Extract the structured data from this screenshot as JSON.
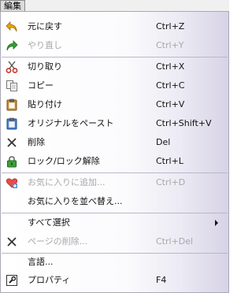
{
  "menubar": {
    "title": "編集"
  },
  "menu": {
    "undo": {
      "label": "元に戻す",
      "shortcut": "Ctrl+Z",
      "icon": "undo-arrow-icon"
    },
    "redo": {
      "label": "やり直し",
      "shortcut": "Ctrl+Y",
      "icon": "redo-arrow-icon"
    },
    "cut": {
      "label": "切り取り",
      "shortcut": "Ctrl+X",
      "icon": "scissors-icon"
    },
    "copy": {
      "label": "コピー",
      "shortcut": "Ctrl+C",
      "icon": "copy-pages-icon"
    },
    "paste": {
      "label": "貼り付け",
      "shortcut": "Ctrl+V",
      "icon": "clipboard-icon"
    },
    "paste_original": {
      "label": "オリジナルをペースト",
      "shortcut": "Ctrl+Shift+V",
      "icon": "clipboard-blue-icon"
    },
    "delete": {
      "label": "削除",
      "shortcut": "Del",
      "icon": "x-delete-icon"
    },
    "lock": {
      "label": "ロック/ロック解除",
      "shortcut": "Ctrl+L",
      "icon": "padlock-icon"
    },
    "add_favorite": {
      "label": "お気に入りに追加...",
      "shortcut": "Ctrl+D",
      "icon": "heart-plus-icon"
    },
    "sort_favorites": {
      "label": "お気に入りを並べ替え..."
    },
    "select_all": {
      "label": "すべて選択"
    },
    "delete_page": {
      "label": "ページの削除...",
      "shortcut": "Ctrl+Del",
      "icon": "x-delete-icon"
    },
    "language": {
      "label": "言語..."
    },
    "properties": {
      "label": "プロパティ",
      "shortcut": "F4",
      "icon": "properties-wrench-icon"
    }
  },
  "colors": {
    "text": "#111111",
    "disabled_text": "#a8a8a8",
    "undo_icon": "#e8a400",
    "redo_icon": "#33a033",
    "lock_icon": "#3aa03a",
    "clipboard": "#c9913a"
  }
}
